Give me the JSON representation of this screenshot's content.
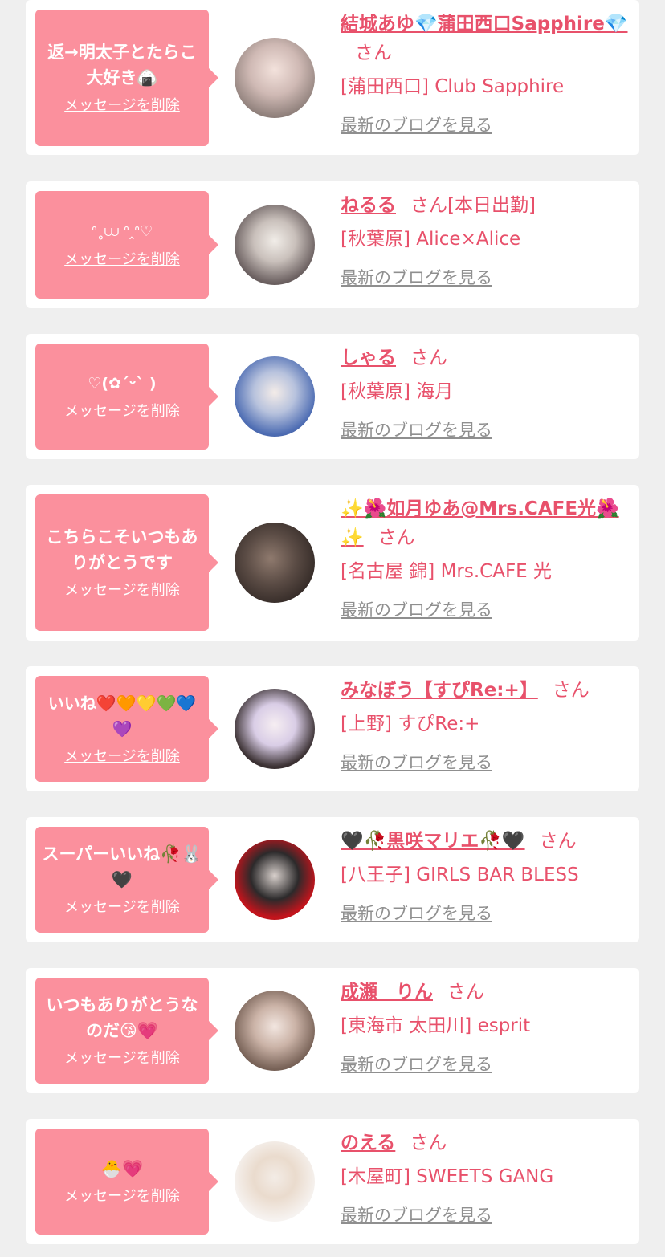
{
  "delete_label": "メッセージを削除",
  "blog_label": "最新のブログを見る",
  "san_label": "さん",
  "entries": [
    {
      "message": "返→明太子とたらこ大好き🍙",
      "name": "結城あゆ💎蒲田西口Sapphire💎",
      "extra": "",
      "shop": "[蒲田西口] Club Sapphire"
    },
    {
      "message": "ᐢ˳⩊ ᐢ‸ᐢ♡",
      "name": "ねるる",
      "extra": "[本日出勤]",
      "shop": "[秋葉原] Alice×Alice"
    },
    {
      "message": "♡(✿ˊᵕˋ )",
      "name": "しゃる",
      "extra": "",
      "shop": "[秋葉原] 海月"
    },
    {
      "message": "こちらこそいつもありがとうです",
      "name": "✨🌺如月ゆあ@Mrs.CAFE光🌺✨",
      "extra": "",
      "shop": "[名古屋 錦] Mrs.CAFE 光"
    },
    {
      "message": "いいね❤️🧡💛💚💙💜",
      "name": "みなぼう【すぴRe:+】",
      "extra": "",
      "shop": "[上野] すぴRe:+"
    },
    {
      "message": "スーパーいいね🥀🐰🖤",
      "name": "🖤🥀黒咲マリエ🥀🖤",
      "extra": "",
      "shop": "[八王子] GIRLS BAR BLESS"
    },
    {
      "message": "いつもありがとうなのだ😘💗",
      "name": "成瀬　りん",
      "extra": "",
      "shop": "[東海市 太田川] esprit"
    },
    {
      "message": "🐣💗",
      "name": "のえる",
      "extra": "",
      "shop": "[木屋町] SWEETS GANG"
    }
  ]
}
